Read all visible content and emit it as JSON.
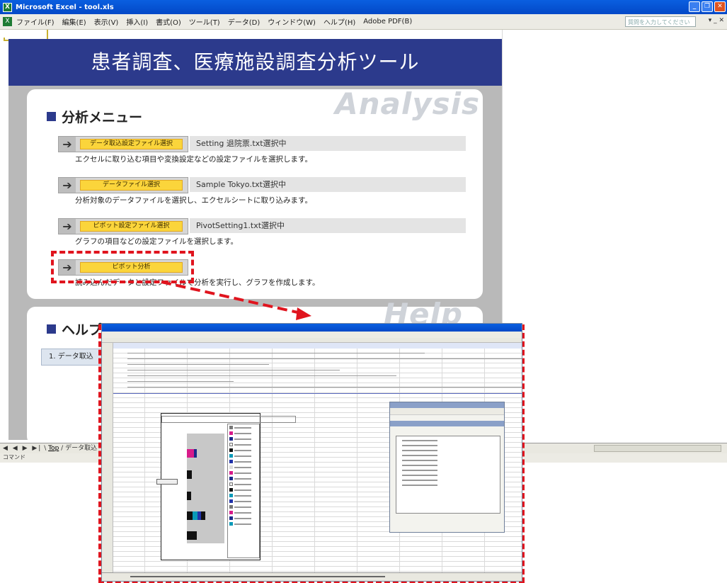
{
  "window": {
    "title": "Microsoft Excel - tool.xls",
    "app_icon": "excel-icon",
    "controls": [
      "minimize",
      "restore",
      "close"
    ]
  },
  "menubar": {
    "items": [
      "ファイル(F)",
      "編集(E)",
      "表示(V)",
      "挿入(I)",
      "書式(O)",
      "ツール(T)",
      "データ(D)",
      "ウィンドウ(W)",
      "ヘルプ(H)",
      "Adobe PDF(B)"
    ],
    "help_placeholder": "質問を入力してください"
  },
  "banner": {
    "title": "患者調査、医療施設調査分析ツール"
  },
  "analysis": {
    "watermark": "Analysis",
    "heading": "分析メニュー",
    "rows": [
      {
        "button": "データ取込設定ファイル選択",
        "status": "Setting 退院票.txt選択中",
        "desc": "エクセルに取り込む項目や変換設定などの設定ファイルを選択します。"
      },
      {
        "button": "データファイル選択",
        "status": "Sample Tokyo.txt選択中",
        "desc": "分析対象のデータファイルを選択し、エクセルシートに取り込みます。"
      },
      {
        "button": "ピボット設定ファイル選択",
        "status": "PivotSetting1.txt選択中",
        "desc": "グラフの項目などの設定ファイルを選択します。"
      },
      {
        "button": "ピボット分析",
        "status": "",
        "desc": "読み込んだデータと設定ファイルで分析を実行し、グラフを作成します。"
      }
    ]
  },
  "help": {
    "watermark": "Help",
    "heading": "ヘルプメニュー",
    "item": "1. データ取込"
  },
  "sheet_tabs": {
    "nav": "◀ ◀ ▶ ▶|",
    "active": "Top",
    "next": "データ取込"
  },
  "statusbar": {
    "text": "コマンド"
  },
  "colors": {
    "banner": "#2c3a8c",
    "button_yellow": "#fbd53b",
    "highlight_red": "#e0141e"
  }
}
